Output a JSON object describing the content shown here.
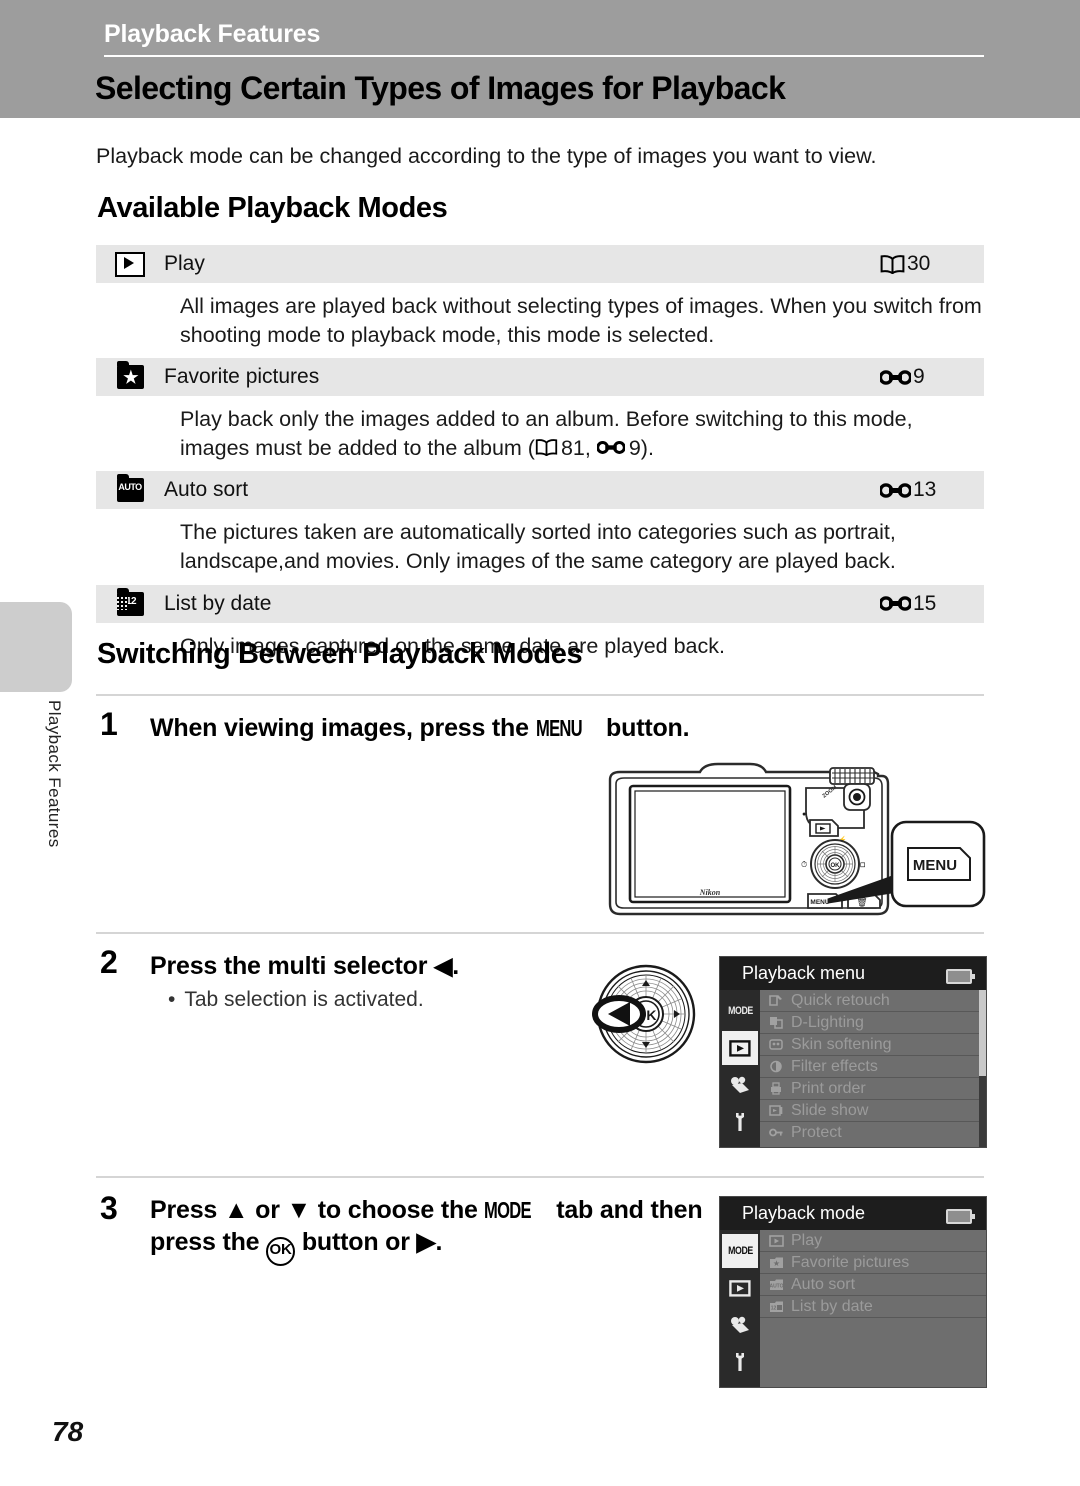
{
  "header": {
    "chapter": "Playback Features",
    "title": "Selecting Certain Types of Images for Playback"
  },
  "edge_tab_label": "Playback Features",
  "intro": "Playback mode can be changed according to the type of images you want to view.",
  "sections": {
    "available": "Available Playback Modes",
    "switching": "Switching Between Playback Modes"
  },
  "modes": [
    {
      "icon": "play-box-icon",
      "name": "Play",
      "ref_type": "book",
      "ref": "30",
      "desc": "All images are played back without selecting types of images. When you switch from shooting mode to playback mode, this mode is selected."
    },
    {
      "icon": "star-folder-icon",
      "name": "Favorite pictures",
      "ref_type": "E",
      "ref": "9",
      "desc_parts": {
        "before": "Play back only the images added to an album. Before switching to this mode, images must be added to the album (",
        "ref1": "81",
        "mid": ", ",
        "ref2": "9",
        "after": ")."
      }
    },
    {
      "icon": "auto-folder-icon",
      "name": "Auto sort",
      "ref_type": "E",
      "ref": "13",
      "desc": "The pictures taken are automatically sorted into categories such as portrait, landscape,and movies. Only images of the same category are played back."
    },
    {
      "icon": "calendar-folder-icon",
      "name": "List by date",
      "ref_type": "E",
      "ref": "15",
      "desc": "Only images captured on the same date are played back."
    }
  ],
  "steps": [
    {
      "number": "1",
      "text_before": "When viewing images, press the ",
      "button": "MENU",
      "text_after": " button."
    },
    {
      "number": "2",
      "text_before": "Press the multi selector ",
      "arrow": "◀",
      "text_after": ".",
      "bullet": "Tab selection is activated."
    },
    {
      "number": "3",
      "line1_a": "Press ",
      "line1_up": "▲",
      "line1_b": " or ",
      "line1_down": "▼",
      "line1_c": " to choose the ",
      "line1_mode": "MODE",
      "line1_d": " tab and then",
      "line2_a": "press the ",
      "line2_ok": "OK",
      "line2_b": " button or ",
      "line2_right": "▶",
      "line2_c": "."
    }
  ],
  "camera_illustration": {
    "callout_label": "MENU",
    "brand": "Nikon",
    "buttons": [
      "record-button",
      "playback-button",
      "multi-selector",
      "menu-button",
      "delete-button"
    ]
  },
  "multi_selector_illustration": {
    "center_label": "OK",
    "highlighted_direction": "left"
  },
  "lcd_playback_menu": {
    "title": "Playback menu",
    "tabs": [
      {
        "name": "MODE",
        "label": "MODE",
        "selected": false
      },
      {
        "name": "playback",
        "label": "",
        "selected": true
      },
      {
        "name": "movie",
        "label": "",
        "selected": false
      },
      {
        "name": "setup",
        "label": "",
        "selected": false
      }
    ],
    "items": [
      "Quick retouch",
      "D-Lighting",
      "Skin softening",
      "Filter effects",
      "Print order",
      "Slide show",
      "Protect"
    ]
  },
  "lcd_playback_mode": {
    "title": "Playback mode",
    "tabs": [
      {
        "name": "MODE",
        "label": "MODE",
        "selected": true
      },
      {
        "name": "playback",
        "label": "",
        "selected": false
      },
      {
        "name": "movie",
        "label": "",
        "selected": false
      },
      {
        "name": "setup",
        "label": "",
        "selected": false
      }
    ],
    "items": [
      "Play",
      "Favorite pictures",
      "Auto sort",
      "List by date"
    ]
  },
  "page_number": "78",
  "colors": {
    "header_band": "#9d9d9d",
    "table_row": "#e6e6e6",
    "edge_tab": "#cdcdcd",
    "lcd_bg": "#1d1d1d",
    "lcd_items_bg": "#6e6e6e"
  }
}
